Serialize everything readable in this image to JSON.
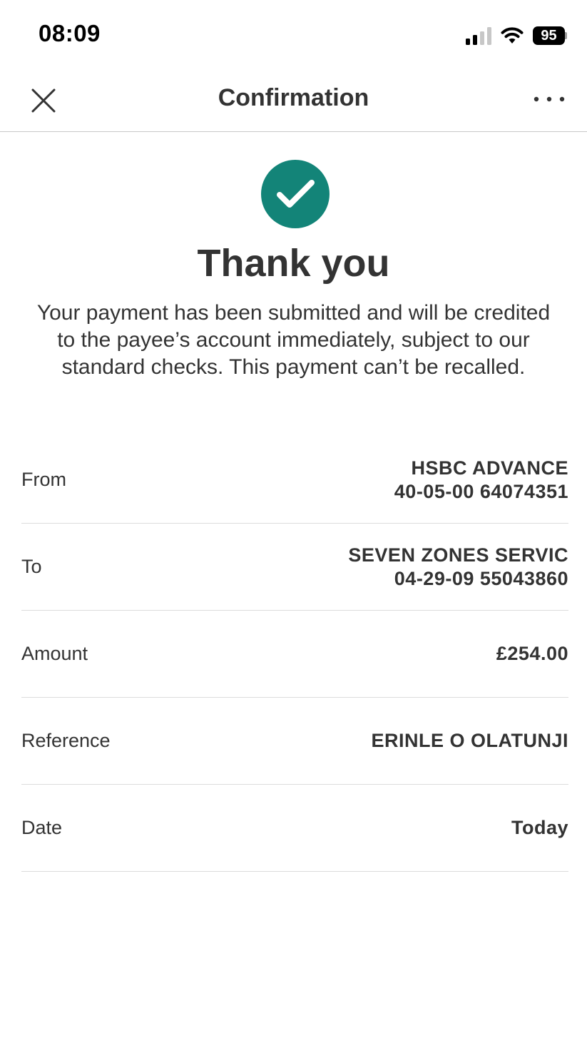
{
  "status_bar": {
    "time": "08:09",
    "battery": "95",
    "icons": [
      "signal-icon",
      "wifi-icon",
      "battery-icon"
    ]
  },
  "nav": {
    "title": "Confirmation",
    "close_icon": "close-icon",
    "more_icon": "more-options-icon"
  },
  "confirmation": {
    "icon": "checkmark-icon",
    "accent_color": "#138478",
    "heading": "Thank you",
    "message": "Your payment has been submitted and will be credited to the payee’s account immediately, subject to our standard checks. This payment can’t be recalled."
  },
  "details": [
    {
      "label": "From",
      "value_line1": "HSBC ADVANCE",
      "value_line2": "40-05-00 64074351"
    },
    {
      "label": "To",
      "value_line1": "SEVEN ZONES SERVIC",
      "value_line2": "04-29-09 55043860"
    },
    {
      "label": "Amount",
      "value_line1": "£254.00"
    },
    {
      "label": "Reference",
      "value_line1": "ERINLE O OLATUNJI"
    },
    {
      "label": "Date",
      "value_line1": "Today"
    }
  ]
}
